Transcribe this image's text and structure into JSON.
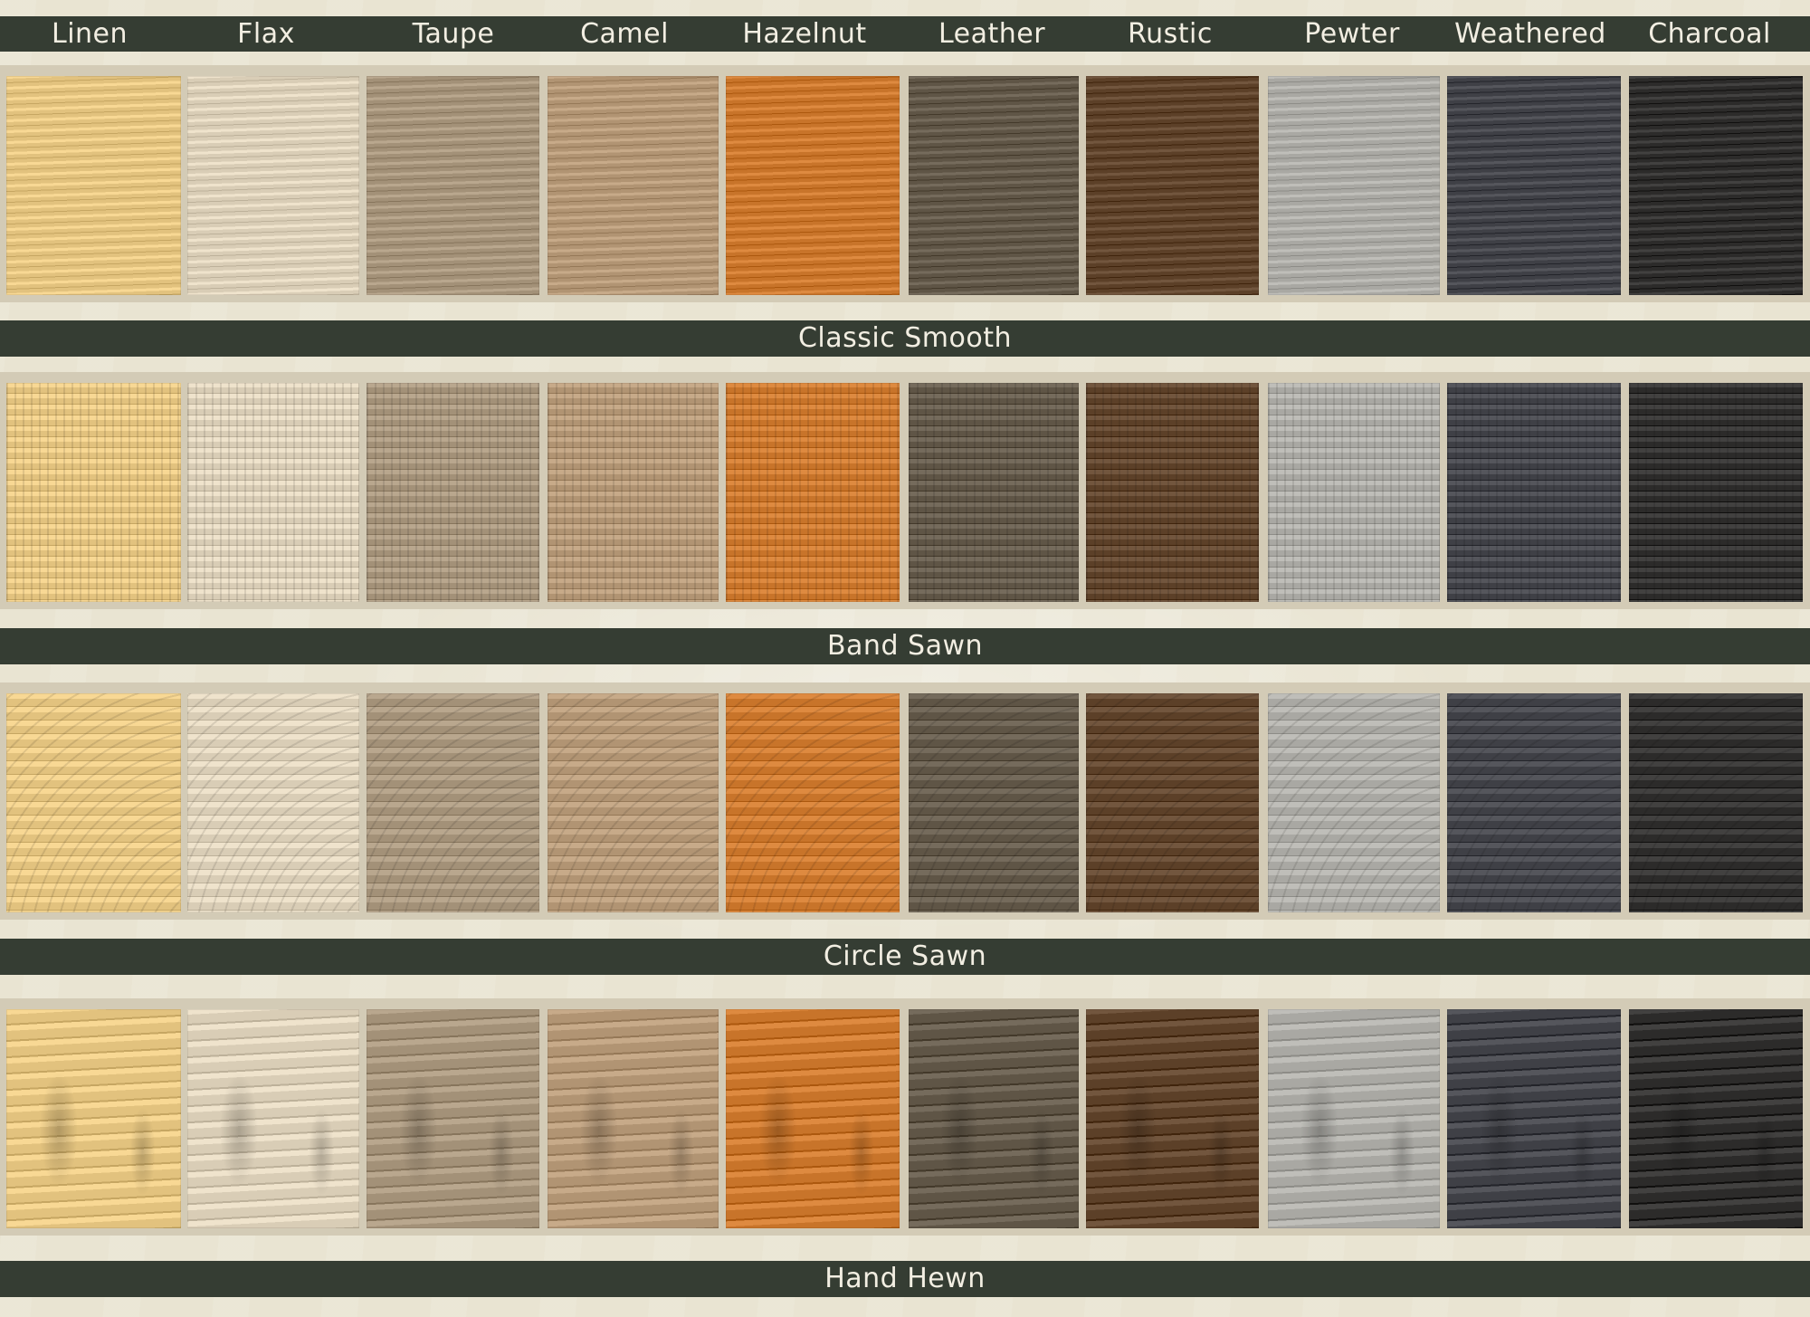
{
  "colors": [
    "Linen",
    "Flax",
    "Taupe",
    "Camel",
    "Hazelnut",
    "Leather",
    "Rustic",
    "Pewter",
    "Weathered",
    "Charcoal"
  ],
  "textures": [
    "Classic Smooth",
    "Band Sawn",
    "Circle Sawn",
    "Hand Hewn"
  ],
  "swatch_tones": [
    "#e2c27e",
    "#d9cdb6",
    "#a39178",
    "#b19473",
    "#c8742a",
    "#5f5546",
    "#5c4028",
    "#a9a8a3",
    "#3f4046",
    "#2c2b2a"
  ]
}
